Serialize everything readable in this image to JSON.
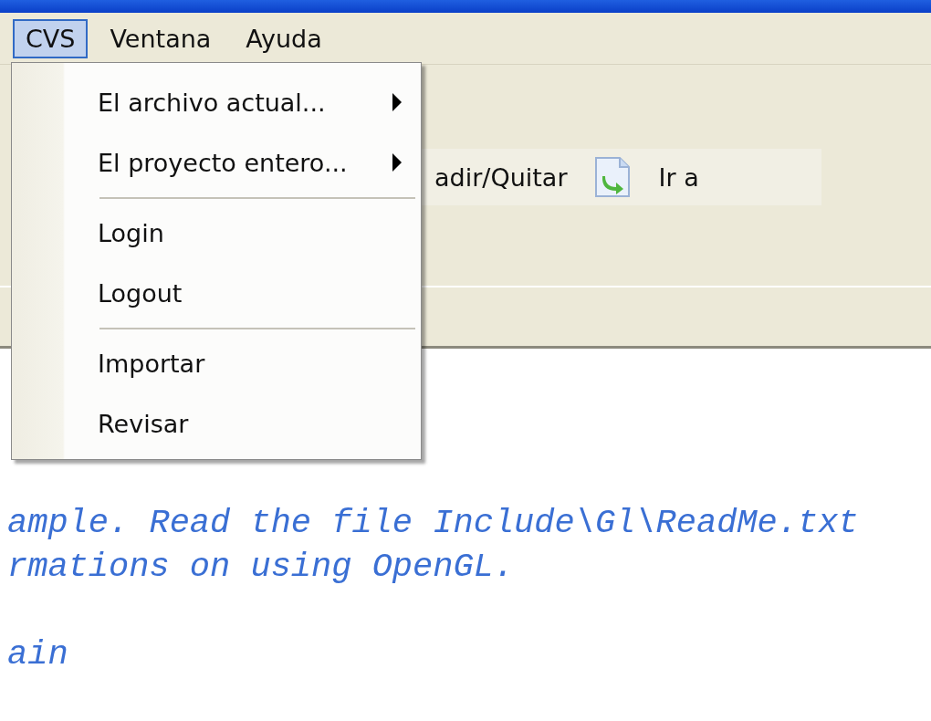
{
  "menubar": [
    {
      "label": "CVS",
      "selected": true
    },
    {
      "label": "Ventana",
      "selected": false
    },
    {
      "label": "Ayuda",
      "selected": false
    }
  ],
  "toolbar": [
    {
      "kind": "text",
      "label": "adir/Quitar"
    },
    {
      "kind": "icon-text",
      "label": "Ir a"
    }
  ],
  "cvs_menu": [
    {
      "kind": "submenu",
      "label": "El archivo actual..."
    },
    {
      "kind": "submenu",
      "label": "El proyecto entero..."
    },
    {
      "kind": "separator"
    },
    {
      "kind": "command",
      "label": "Login"
    },
    {
      "kind": "command",
      "label": "Logout"
    },
    {
      "kind": "separator"
    },
    {
      "kind": "command",
      "label": "Importar"
    },
    {
      "kind": "command",
      "label": "Revisar"
    }
  ],
  "editor": {
    "lines": [
      "ample. Read the file Include\\Gl\\ReadMe.txt",
      "rmations on using OpenGL.",
      "ain"
    ]
  }
}
